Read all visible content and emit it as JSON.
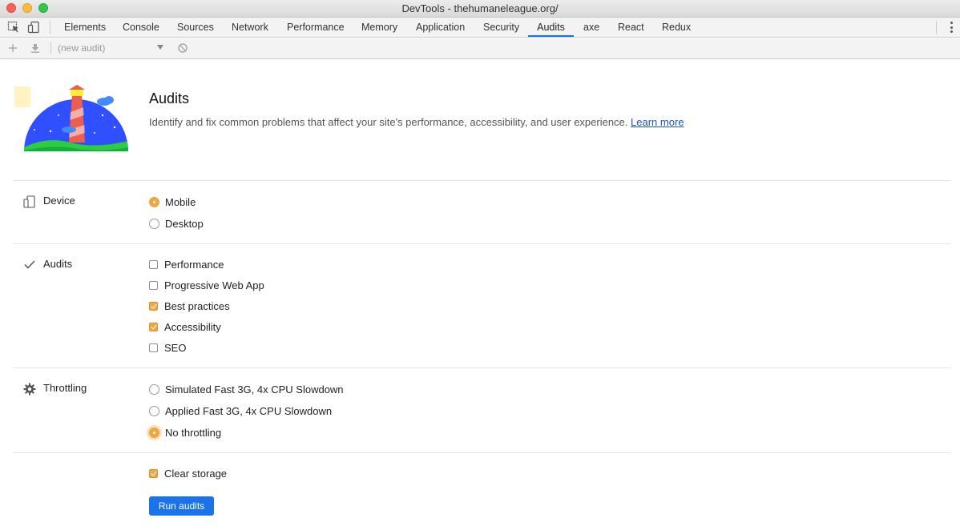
{
  "window": {
    "title": "DevTools - thehumaneleague.org/"
  },
  "tabs": [
    {
      "label": "Elements"
    },
    {
      "label": "Console"
    },
    {
      "label": "Sources"
    },
    {
      "label": "Network"
    },
    {
      "label": "Performance"
    },
    {
      "label": "Memory"
    },
    {
      "label": "Application"
    },
    {
      "label": "Security"
    },
    {
      "label": "Audits",
      "active": true
    },
    {
      "label": "axe"
    },
    {
      "label": "React"
    },
    {
      "label": "Redux"
    }
  ],
  "toolbar": {
    "audit_select_value": "(new audit)",
    "icons": [
      "plus-icon",
      "download-icon",
      "clear-icon"
    ]
  },
  "header": {
    "title": "Audits",
    "description": "Identify and fix common problems that affect your site's performance, accessibility, and user experience.",
    "learn_more": "Learn more"
  },
  "device": {
    "label": "Device",
    "options": [
      {
        "label": "Mobile",
        "selected": true
      },
      {
        "label": "Desktop",
        "selected": false
      }
    ]
  },
  "audits": {
    "label": "Audits",
    "options": [
      {
        "label": "Performance",
        "checked": false
      },
      {
        "label": "Progressive Web App",
        "checked": false
      },
      {
        "label": "Best practices",
        "checked": true
      },
      {
        "label": "Accessibility",
        "checked": true
      },
      {
        "label": "SEO",
        "checked": false
      }
    ]
  },
  "throttling": {
    "label": "Throttling",
    "options": [
      {
        "label": "Simulated Fast 3G, 4x CPU Slowdown",
        "selected": false
      },
      {
        "label": "Applied Fast 3G, 4x CPU Slowdown",
        "selected": false
      },
      {
        "label": "No throttling",
        "selected": true
      }
    ]
  },
  "clear_storage": {
    "label": "Clear storage",
    "checked": true
  },
  "run_button": {
    "label": "Run audits"
  },
  "colors": {
    "accent": "#f1a741",
    "primary": "#1a73e8",
    "link": "#1a55c4"
  }
}
